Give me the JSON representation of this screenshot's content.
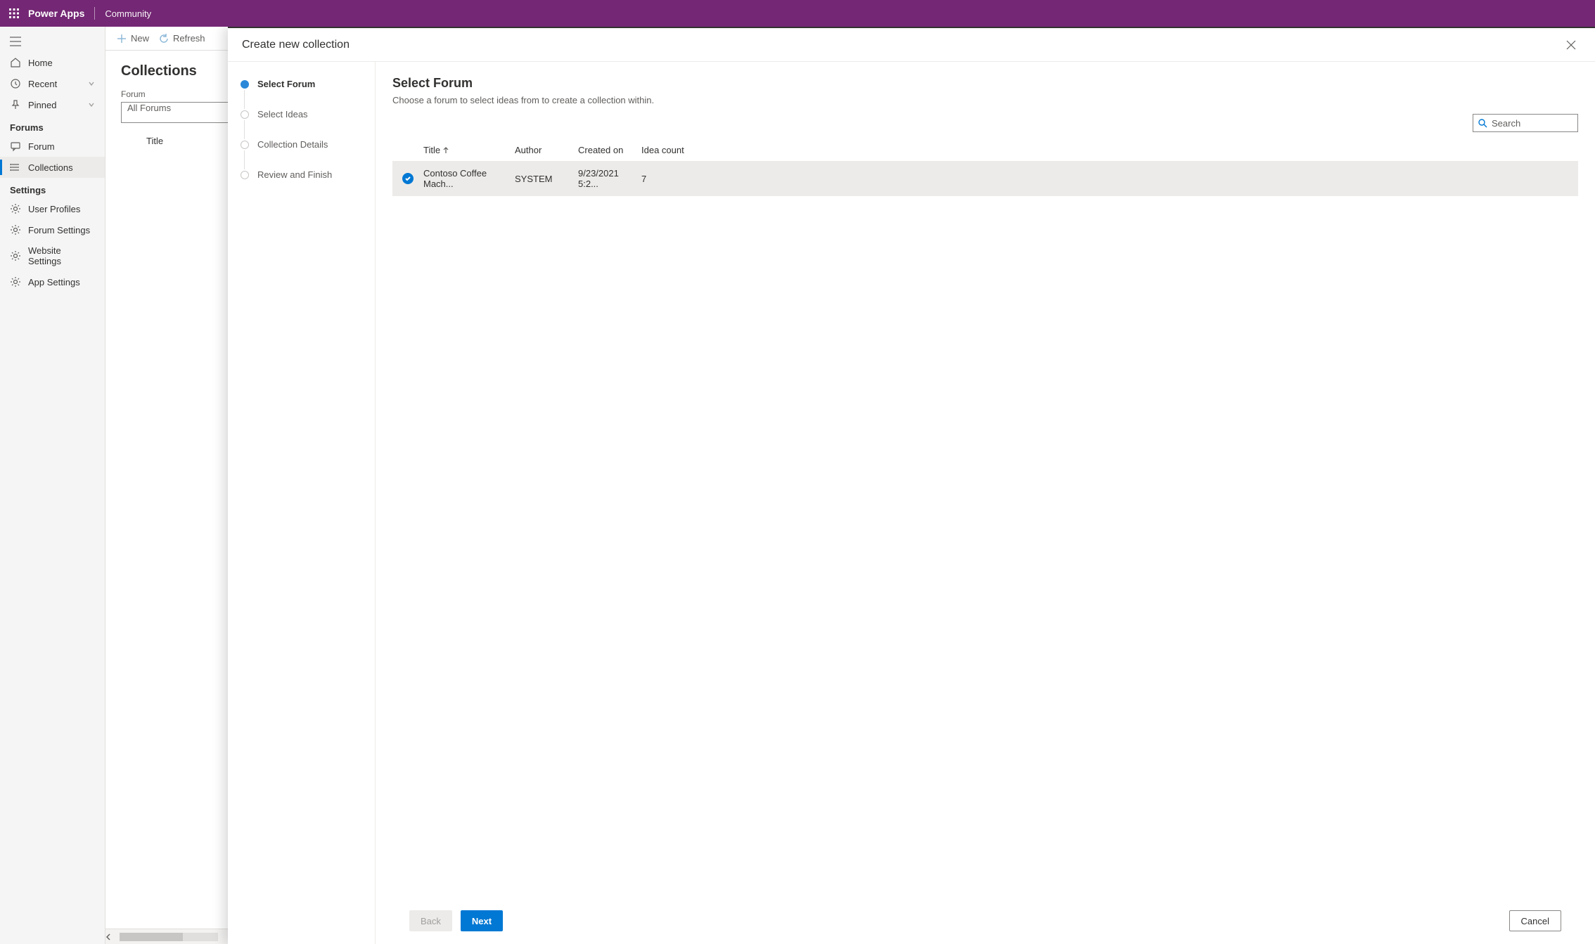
{
  "header": {
    "brand": "Power Apps",
    "environment": "Community"
  },
  "nav": {
    "home": "Home",
    "recent": "Recent",
    "pinned": "Pinned",
    "sections": {
      "forums": {
        "label": "Forums",
        "items": {
          "forum": "Forum",
          "collections": "Collections"
        }
      },
      "settings": {
        "label": "Settings",
        "items": {
          "user_profiles": "User Profiles",
          "forum_settings": "Forum Settings",
          "website_settings": "Website Settings",
          "app_settings": "App Settings"
        }
      }
    }
  },
  "commands": {
    "new": "New",
    "refresh": "Refresh"
  },
  "content": {
    "title": "Collections",
    "forum_label": "Forum",
    "forum_value": "All Forums",
    "col_title": "Title"
  },
  "panel": {
    "title": "Create new collection",
    "steps": [
      "Select Forum",
      "Select Ideas",
      "Collection Details",
      "Review and Finish"
    ],
    "active_step": 0,
    "main_heading": "Select Forum",
    "main_sub": "Choose a forum to select ideas from to create a collection within.",
    "search_placeholder": "Search",
    "grid": {
      "cols": {
        "title": "Title",
        "author": "Author",
        "created": "Created on",
        "count": "Idea count"
      },
      "rows": [
        {
          "title": "Contoso Coffee Mach...",
          "author": "SYSTEM",
          "created": "9/23/2021 5:2...",
          "count": "7",
          "selected": true
        }
      ]
    },
    "buttons": {
      "back": "Back",
      "next": "Next",
      "cancel": "Cancel"
    }
  }
}
